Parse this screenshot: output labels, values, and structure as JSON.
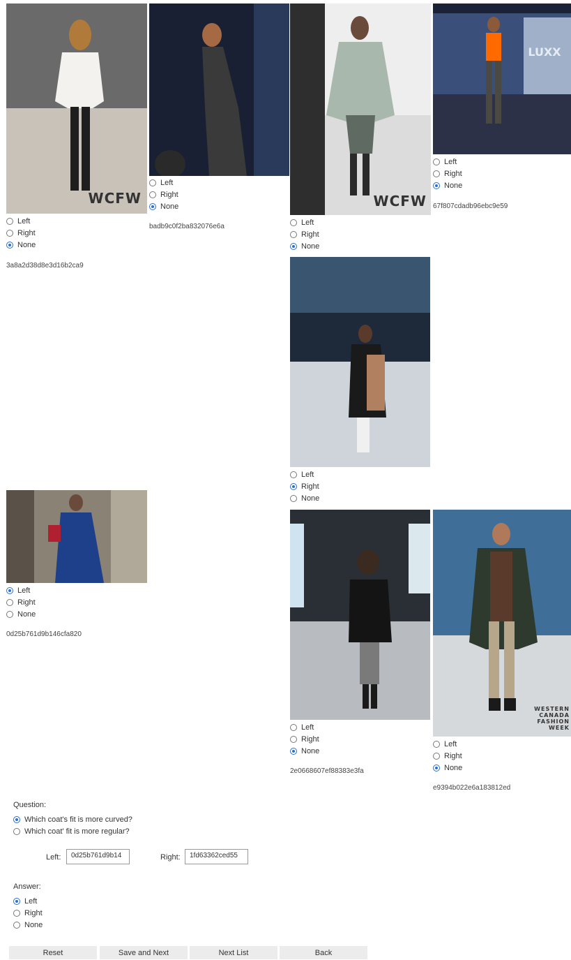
{
  "images": [
    {
      "hash": "3a8a2d38d8e3d16b2ca9",
      "watermark": "WCFW",
      "selected": "None"
    },
    {
      "hash": "badb9c0f2ba832076e6a",
      "selected": "None"
    },
    {
      "watermark": "WCFW",
      "selected": "None"
    },
    {
      "hash": "67f807cdadb96ebc9e59",
      "selected": "None"
    },
    {
      "selected": "Right"
    },
    {
      "hash": "0d25b761d9b146cfa820",
      "selected": "Left"
    },
    {
      "hash": "2e0668607ef88383e3fa",
      "selected": "None"
    },
    {
      "hash": "e9394b022e6a183812ed",
      "watermark": "WESTERN CANADA FASHION WEEK",
      "selected": "None"
    }
  ],
  "radio_labels": {
    "left": "Left",
    "right": "Right",
    "none": "None"
  },
  "question": {
    "label": "Question:",
    "options": [
      "Which coat's fit is more curved?",
      "Which coat' fit is more regular?"
    ],
    "selected": 0
  },
  "fields": {
    "left_label": "Left:",
    "left_value": "0d25b761d9b14",
    "right_label": "Right:",
    "right_value": "1fd63362ced55"
  },
  "answer": {
    "label": "Answer:",
    "selected": "Left"
  },
  "buttons": {
    "reset": "Reset",
    "save_next": "Save and Next",
    "next_list": "Next List",
    "back": "Back"
  }
}
